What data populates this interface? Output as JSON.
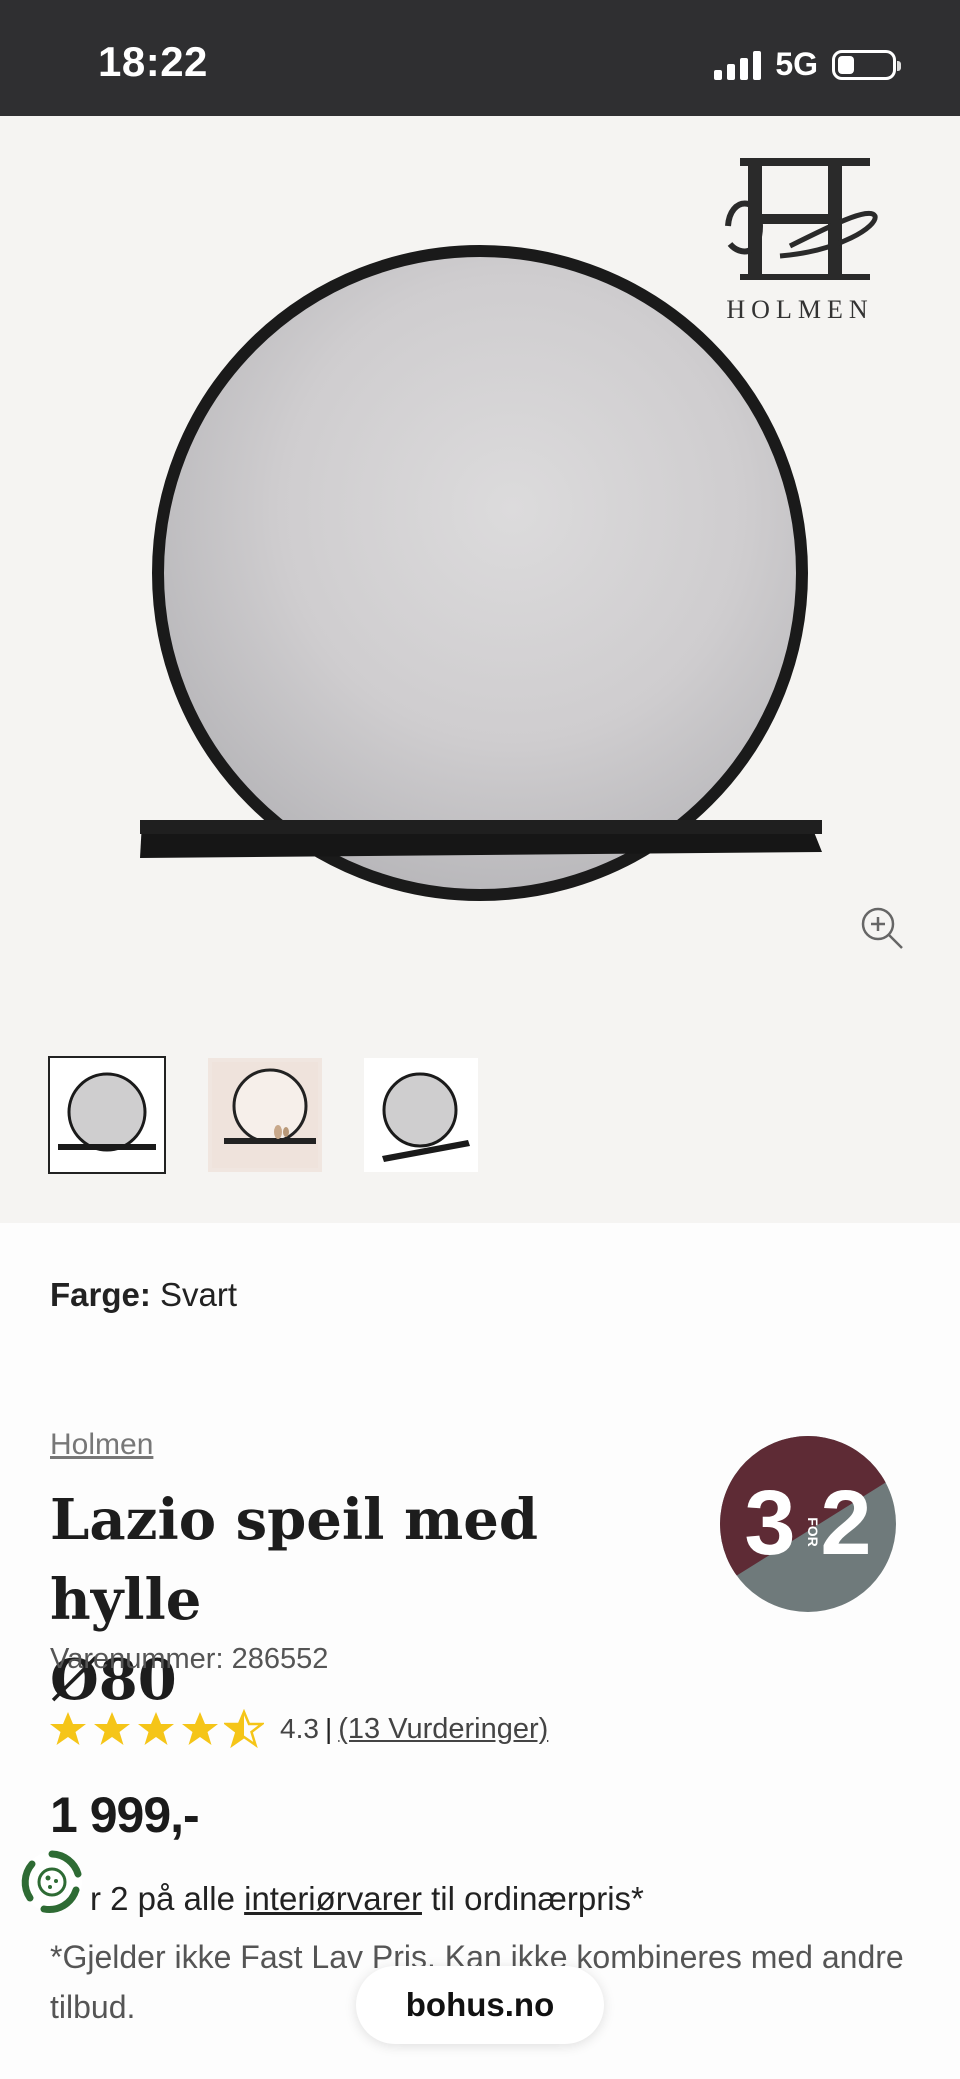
{
  "status_bar": {
    "time": "18:22",
    "network": "5G",
    "icons": [
      "signal-bars-icon",
      "battery-icon"
    ]
  },
  "gallery": {
    "brand_logo_text": "HOLMEN",
    "zoom_icon": "zoom-in-icon",
    "thumbnails": [
      {
        "name": "thumbnail-front",
        "selected": true
      },
      {
        "name": "thumbnail-room",
        "selected": false
      },
      {
        "name": "thumbnail-angle",
        "selected": false
      }
    ]
  },
  "product": {
    "color_label": "Farge:",
    "color_value": "Svart",
    "brand": "Holmen",
    "title_line1": "Lazio speil med hylle",
    "title_line2": "Ø80",
    "sku": "Varenummer: 286552",
    "rating": {
      "value": "4.3",
      "separator": "|",
      "count_text": "(13 Vurderinger)",
      "stars": 4.3
    },
    "price": "1 999,-",
    "badge": {
      "big_left": "3",
      "small": "FOR",
      "big_right": "2",
      "colors": [
        "#5e2b35",
        "#6f7a7b"
      ]
    }
  },
  "promo": {
    "line_before": "r 2 på alle",
    "link": "interiørvarer",
    "line_after": "til ordinærpris*",
    "note": "*Gjelder ikke Fast Lav Pris. Kan ikke kombineres med andre tilbud."
  },
  "browser": {
    "url": "bohus.no"
  },
  "colors": {
    "status_bar": "#2f2f31",
    "gallery_bg": "#f5f4f2",
    "star": "#f5c518"
  }
}
